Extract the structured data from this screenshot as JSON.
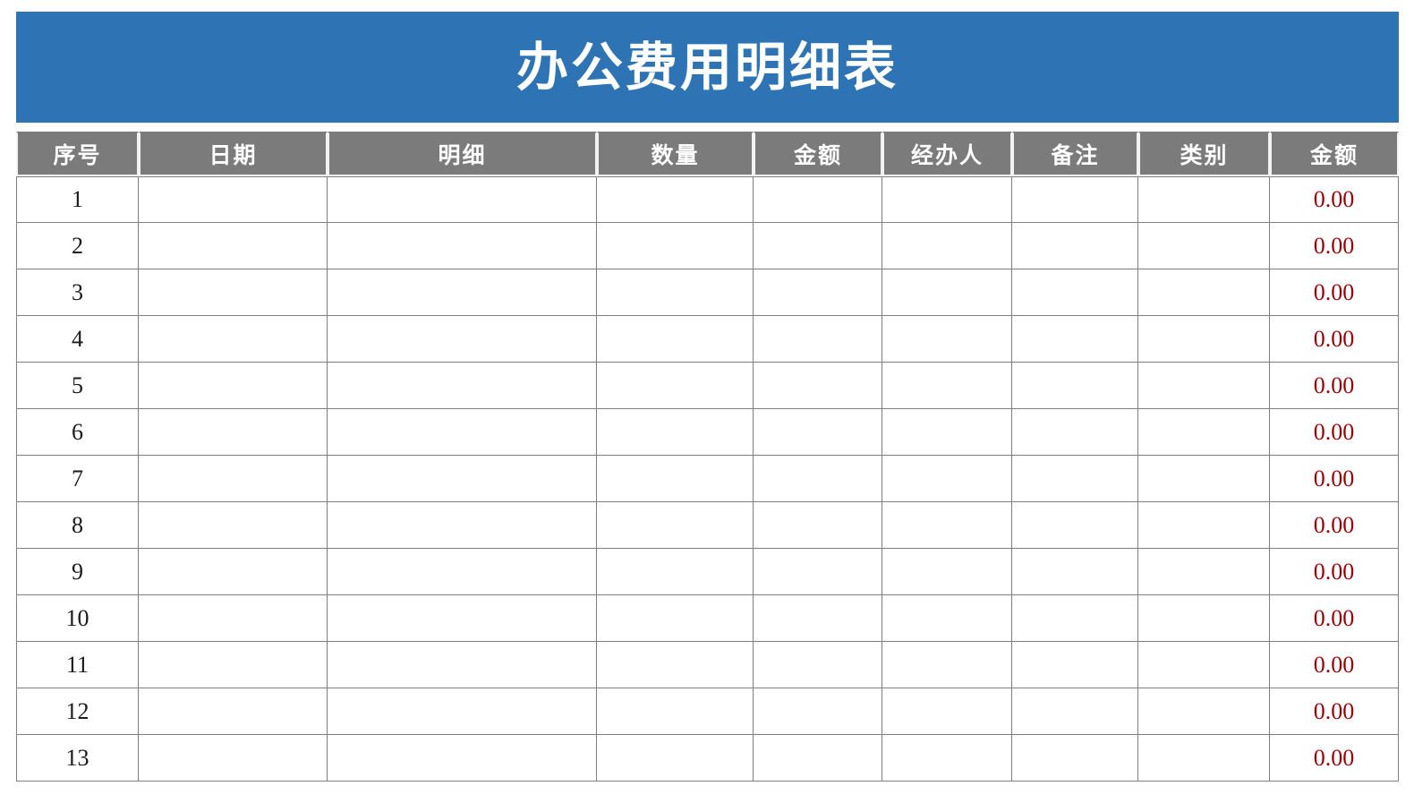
{
  "document": {
    "title": "办公费用明细表"
  },
  "table": {
    "headers": [
      "序号",
      "日期",
      "明细",
      "数量",
      "金额",
      "经办人",
      "备注",
      "类别",
      "金额"
    ],
    "rows": [
      {
        "index": "1",
        "date": "",
        "detail": "",
        "quantity": "",
        "amount": "",
        "handler": "",
        "remark": "",
        "category": "",
        "total": "0.00"
      },
      {
        "index": "2",
        "date": "",
        "detail": "",
        "quantity": "",
        "amount": "",
        "handler": "",
        "remark": "",
        "category": "",
        "total": "0.00"
      },
      {
        "index": "3",
        "date": "",
        "detail": "",
        "quantity": "",
        "amount": "",
        "handler": "",
        "remark": "",
        "category": "",
        "total": "0.00"
      },
      {
        "index": "4",
        "date": "",
        "detail": "",
        "quantity": "",
        "amount": "",
        "handler": "",
        "remark": "",
        "category": "",
        "total": "0.00"
      },
      {
        "index": "5",
        "date": "",
        "detail": "",
        "quantity": "",
        "amount": "",
        "handler": "",
        "remark": "",
        "category": "",
        "total": "0.00"
      },
      {
        "index": "6",
        "date": "",
        "detail": "",
        "quantity": "",
        "amount": "",
        "handler": "",
        "remark": "",
        "category": "",
        "total": "0.00"
      },
      {
        "index": "7",
        "date": "",
        "detail": "",
        "quantity": "",
        "amount": "",
        "handler": "",
        "remark": "",
        "category": "",
        "total": "0.00"
      },
      {
        "index": "8",
        "date": "",
        "detail": "",
        "quantity": "",
        "amount": "",
        "handler": "",
        "remark": "",
        "category": "",
        "total": "0.00"
      },
      {
        "index": "9",
        "date": "",
        "detail": "",
        "quantity": "",
        "amount": "",
        "handler": "",
        "remark": "",
        "category": "",
        "total": "0.00"
      },
      {
        "index": "10",
        "date": "",
        "detail": "",
        "quantity": "",
        "amount": "",
        "handler": "",
        "remark": "",
        "category": "",
        "total": "0.00"
      },
      {
        "index": "11",
        "date": "",
        "detail": "",
        "quantity": "",
        "amount": "",
        "handler": "",
        "remark": "",
        "category": "",
        "total": "0.00"
      },
      {
        "index": "12",
        "date": "",
        "detail": "",
        "quantity": "",
        "amount": "",
        "handler": "",
        "remark": "",
        "category": "",
        "total": "0.00"
      },
      {
        "index": "13",
        "date": "",
        "detail": "",
        "quantity": "",
        "amount": "",
        "handler": "",
        "remark": "",
        "category": "",
        "total": "0.00"
      }
    ]
  },
  "colors": {
    "title_bar": "#2E74B5",
    "header_row": "#7B7B7B",
    "amount_text": "#9C0006",
    "grid_line": "#808080",
    "cell_background": "#FFFFFF"
  }
}
